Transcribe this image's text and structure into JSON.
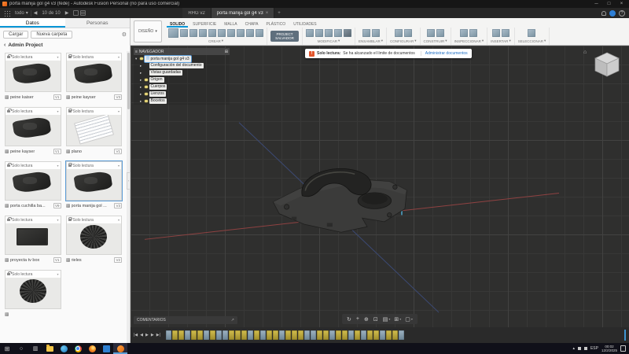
{
  "glyphs": {
    "caret_down": "▾",
    "caret_right": "▸",
    "back": "‹",
    "prev": "◀",
    "next": "▶",
    "close": "×",
    "plus": "+",
    "minimize": "─",
    "maximize": "□",
    "help": "?",
    "gear": "⚙",
    "menu": "≡",
    "pane": "⊞",
    "home": "⌂",
    "warn": "!",
    "expand": "↗",
    "tray_chevron": "▴"
  },
  "titlebar": {
    "title": "porta manija gol g4 v3 (fede) - Autodesk Fusion Personal (no para uso comercial)"
  },
  "tabbar": {
    "scope": "todo",
    "counter": "10 de 10",
    "tabs": [
      {
        "label": "RHG v2",
        "state": ""
      },
      {
        "label": "porta manija gol g4 v3",
        "state": "active"
      }
    ]
  },
  "ribbon": {
    "workspace": "DISEÑO",
    "tabs": [
      {
        "label": "SOLIDO",
        "state": "active"
      },
      {
        "label": "SUPERFICIE",
        "state": ""
      },
      {
        "label": "MALLA",
        "state": ""
      },
      {
        "label": "CHAPA",
        "state": ""
      },
      {
        "label": "PLÁSTICO",
        "state": ""
      },
      {
        "label": "UTILIDADES",
        "state": ""
      }
    ],
    "groups": [
      {
        "label": "CREAR",
        "icons": [
          "primitive",
          "extrude",
          "revolve",
          "sweep",
          "loft",
          "coil",
          "rib",
          "hole",
          "thread",
          "pattern"
        ]
      },
      {
        "label": "PROJECT SALVADOR"
      },
      {
        "label": "MODIFICAR",
        "icons": [
          "press-pull",
          "fillet",
          "shell",
          "combine",
          "move"
        ]
      },
      {
        "label": "ENSAMBLAR",
        "icons": [
          "new-component",
          "joint"
        ]
      },
      {
        "label": "CONFIGURAR",
        "icons": [
          "configuration",
          "variant"
        ]
      },
      {
        "label": "CONSTRUIR",
        "icons": [
          "plane",
          "axis"
        ]
      },
      {
        "label": "INSPECCIONAR",
        "icons": [
          "measure",
          "section"
        ]
      },
      {
        "label": "INSERTAR",
        "icons": [
          "insert-mesh",
          "decal"
        ]
      },
      {
        "label": "SELECCIONAR",
        "icons": [
          "select"
        ]
      }
    ]
  },
  "datapanel": {
    "tabs": [
      {
        "label": "Datos",
        "state": "active"
      },
      {
        "label": "Personas",
        "state": ""
      }
    ],
    "upload": "Cargar",
    "new_folder": "Nueva carpeta",
    "project": "Admin Project",
    "readonly": "Solo lectura",
    "items": [
      {
        "name": "peine kaiser",
        "version": "V1",
        "thumb": "part-dark",
        "state": ""
      },
      {
        "name": "peine kayser",
        "version": "V3",
        "thumb": "part-dark",
        "state": ""
      },
      {
        "name": "peine kayser",
        "version": "V1",
        "thumb": "part-dark",
        "state": ""
      },
      {
        "name": "plano",
        "version": "V1",
        "thumb": "drawing",
        "state": ""
      },
      {
        "name": "porta cuchilla ba...",
        "version": "V9",
        "thumb": "part-dark",
        "state": ""
      },
      {
        "name": "porta manija gol ...",
        "version": "V3",
        "thumb": "part-dark",
        "state": "selected"
      },
      {
        "name": "proyecta tv box",
        "version": "V1",
        "thumb": "box-dark",
        "state": ""
      },
      {
        "name": "rieles",
        "version": "V2",
        "thumb": "knurl",
        "state": ""
      },
      {
        "name": "",
        "version": "",
        "thumb": "knurl",
        "state": ""
      }
    ]
  },
  "browser": {
    "title": "NAVEGADOR",
    "rows": [
      {
        "arrow": "▾",
        "label": "porta manija gol g4 v3",
        "state": "selected",
        "bulb": "with-bulb",
        "indent": ""
      },
      {
        "arrow": "▸",
        "label": "Configuración del documento",
        "state": "",
        "bulb": "no-bulb",
        "indent": "child"
      },
      {
        "arrow": "▸",
        "label": "Vistas guardadas",
        "state": "",
        "bulb": "no-bulb",
        "indent": "child"
      },
      {
        "arrow": "▸",
        "label": "Origen",
        "state": "",
        "bulb": "with-bulb",
        "indent": "child"
      },
      {
        "arrow": "▸",
        "label": "Cuerpos",
        "state": "",
        "bulb": "with-bulb",
        "indent": "child"
      },
      {
        "arrow": "▸",
        "label": "Lienzos",
        "state": "",
        "bulb": "with-bulb",
        "indent": "child"
      },
      {
        "arrow": "▸",
        "label": "Bocetos",
        "state": "",
        "bulb": "with-bulb",
        "indent": "child"
      }
    ]
  },
  "warning": {
    "label": "Solo lectura:",
    "message": "Se ha alcanzado el límite de documentos",
    "action": "Administrar documentos"
  },
  "comments": {
    "label": "COMENTARIOS"
  },
  "navbar": {
    "icons": [
      {
        "name": "orbit-icon",
        "glyph": "↻",
        "caret": ""
      },
      {
        "name": "pan-icon",
        "glyph": "+",
        "caret": ""
      },
      {
        "name": "zoom-icon",
        "glyph": "⊕",
        "caret": ""
      },
      {
        "name": "fit-icon",
        "glyph": "⊡",
        "caret": ""
      },
      {
        "name": "display-settings-icon",
        "glyph": "▤",
        "caret": "▾"
      },
      {
        "name": "grid-settings-icon",
        "glyph": "⊞",
        "caret": "▾"
      },
      {
        "name": "viewports-icon",
        "glyph": "▢",
        "caret": "▾"
      }
    ]
  },
  "timeline": {
    "controls": [
      {
        "name": "go-to-start-button",
        "glyph": "|◀"
      },
      {
        "name": "step-back-button",
        "glyph": "◀"
      },
      {
        "name": "play-button",
        "glyph": "▶"
      },
      {
        "name": "step-forward-button",
        "glyph": "▶"
      },
      {
        "name": "go-to-end-button",
        "glyph": "▶|"
      }
    ],
    "features": [
      "feature",
      "sketch",
      "sketch",
      "feature",
      "sketch",
      "sketch",
      "feature",
      "sketch",
      "feature",
      "feature",
      "sketch",
      "sketch",
      "sketch",
      "feature",
      "sketch",
      "feature",
      "sketch",
      "sketch",
      "feature",
      "sketch",
      "sketch",
      "sketch",
      "feature",
      "feature",
      "sketch",
      "sketch",
      "feature",
      "sketch",
      "sketch",
      "feature",
      "sketch",
      "feature",
      "sketch",
      "sketch",
      "feature",
      "sketch",
      "sketch",
      "feature"
    ]
  },
  "taskbar": {
    "apps": [
      {
        "name": "start-button",
        "type": "start",
        "glyph": "⊞",
        "state": ""
      },
      {
        "name": "search-icon",
        "type": "search",
        "glyph": "○",
        "state": ""
      },
      {
        "name": "task-view-icon",
        "type": "taskview",
        "glyph": "▥",
        "state": ""
      },
      {
        "name": "file-explorer-icon",
        "type": "folder",
        "glyph": "",
        "state": ""
      },
      {
        "name": "edge-icon",
        "type": "edge",
        "glyph": "",
        "state": ""
      },
      {
        "name": "chrome-icon",
        "type": "chrome",
        "glyph": "",
        "state": ""
      },
      {
        "name": "firefox-icon",
        "type": "firefox",
        "glyph": "",
        "state": ""
      },
      {
        "name": "mail-icon",
        "type": "mail",
        "glyph": "",
        "state": ""
      },
      {
        "name": "fusion-icon",
        "type": "fusion",
        "glyph": "",
        "state": "active"
      }
    ],
    "tray": {
      "lang": "ESP",
      "time": "00:02",
      "date": "12/2/2025"
    }
  }
}
